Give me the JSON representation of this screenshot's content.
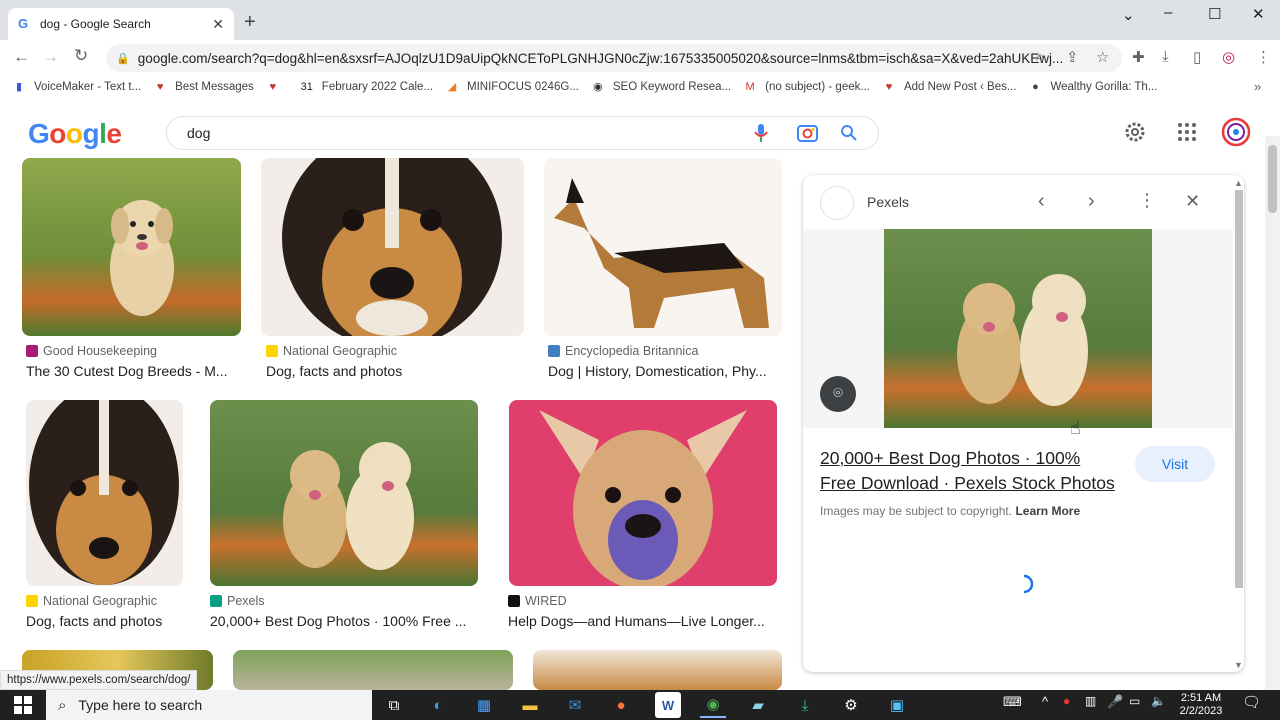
{
  "browser": {
    "tab_title": "dog - Google Search",
    "tab_close": "✕",
    "new_tab": "+",
    "url": "google.com/search?q=dog&hl=en&sxsrf=AJOqlzU1D9aUipQkNCEToPLGNHJGN0cZjw:1675335005020&source=lnms&tbm=isch&sa=X&ved=2ahUKEwj...",
    "status_url": "https://www.pexels.com/search/dog/"
  },
  "bookmarks": [
    {
      "label": "VoiceMaker - Text t...",
      "color": "#3b5bdb"
    },
    {
      "label": "Best Messages",
      "color": "#c0392b"
    },
    {
      "label": "",
      "color": "#c0392b"
    },
    {
      "label": "February 2022 Cale...",
      "color": "#222222"
    },
    {
      "label": "MINIFOCUS 0246G...",
      "color": "#e67e22"
    },
    {
      "label": "SEO Keyword Resea...",
      "color": "#333333"
    },
    {
      "label": "(no subject) - geek...",
      "color": "#d93025"
    },
    {
      "label": "Add New Post ‹ Bes...",
      "color": "#c0392b"
    },
    {
      "label": "Wealthy Gorilla: Th...",
      "color": "#444444"
    }
  ],
  "google": {
    "logo": "Google",
    "query": "dog"
  },
  "results": [
    {
      "source": "Good Housekeeping",
      "caption": "The 30 Cutest Dog Breeds - M...",
      "fav_color": "#a61c73"
    },
    {
      "source": "National Geographic",
      "caption": "Dog, facts and photos",
      "fav_color": "#ffd400"
    },
    {
      "source": "Encyclopedia Britannica",
      "caption": "Dog | History, Domestication, Phy...",
      "fav_color": "#3f7fbf"
    },
    {
      "source": "National Geographic",
      "caption": "Dog, facts and photos",
      "fav_color": "#ffd400"
    },
    {
      "source": "Pexels",
      "caption": "20,000+ Best Dog Photos · 100% Free ...",
      "fav_color": "#05a081"
    },
    {
      "source": "WIRED",
      "caption": "Help Dogs—and Humans—Live Longer...",
      "fav_color": "#111111"
    }
  ],
  "panel": {
    "source": "Pexels",
    "title_line1": "20,000+ Best Dog Photos · 100%",
    "title_line2": "Free Download · Pexels Stock Photos",
    "copyright": "Images may be subject to copyright.",
    "learn_more": "Learn More",
    "visit": "Visit"
  },
  "taskbar": {
    "search_placeholder": "Type here to search",
    "time": "2:51 AM",
    "date": "2/2/2023"
  }
}
